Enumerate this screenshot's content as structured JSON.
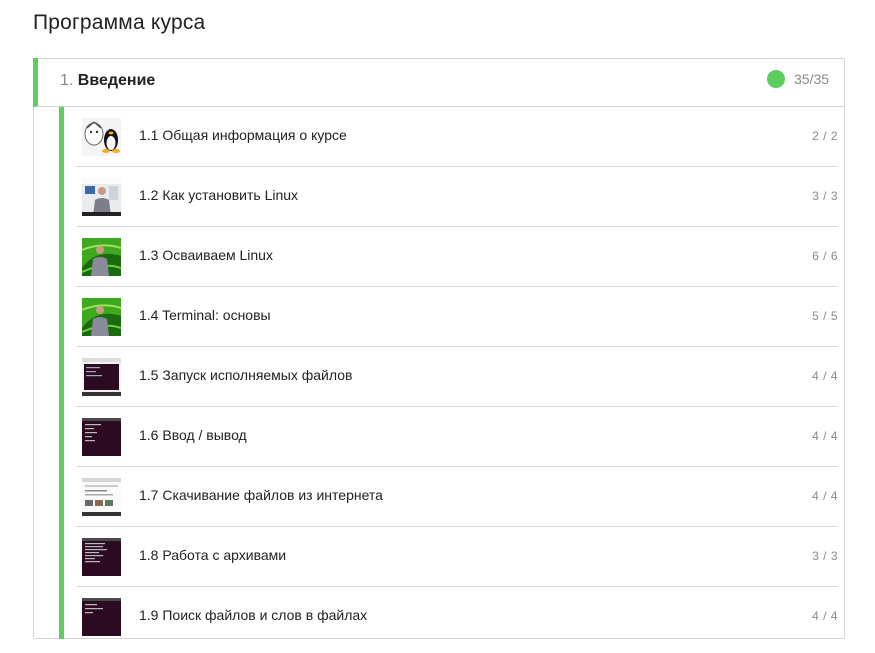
{
  "page": {
    "title": "Программа курса"
  },
  "module": {
    "number": "1.",
    "name": "Введение",
    "progress": "35/35",
    "status_color": "#5ccd5c",
    "accent_color": "#5fcd5f"
  },
  "lessons": [
    {
      "title": "1.1 Общая информация о курсе",
      "progress": "2 / 2",
      "thumbnail": "gnu-tux-logo"
    },
    {
      "title": "1.2 Как установить Linux",
      "progress": "3 / 3",
      "thumbnail": "video-presenter-screen"
    },
    {
      "title": "1.3 Осваиваем Linux",
      "progress": "6 / 6",
      "thumbnail": "video-presenter-green"
    },
    {
      "title": "1.4 Terminal: основы",
      "progress": "5 / 5",
      "thumbnail": "video-presenter-green"
    },
    {
      "title": "1.5 Запуск исполняемых файлов",
      "progress": "4 / 4",
      "thumbnail": "terminal-window-screenshot"
    },
    {
      "title": "1.6 Ввод / вывод",
      "progress": "4 / 4",
      "thumbnail": "terminal-screenshot"
    },
    {
      "title": "1.7 Скачивание файлов из интернета",
      "progress": "4 / 4",
      "thumbnail": "browser-screenshot"
    },
    {
      "title": "1.8 Работа с архивами",
      "progress": "3 / 3",
      "thumbnail": "terminal-screenshot"
    },
    {
      "title": "1.9 Поиск файлов и слов в файлах",
      "progress": "4 / 4",
      "thumbnail": "terminal-screenshot"
    }
  ]
}
